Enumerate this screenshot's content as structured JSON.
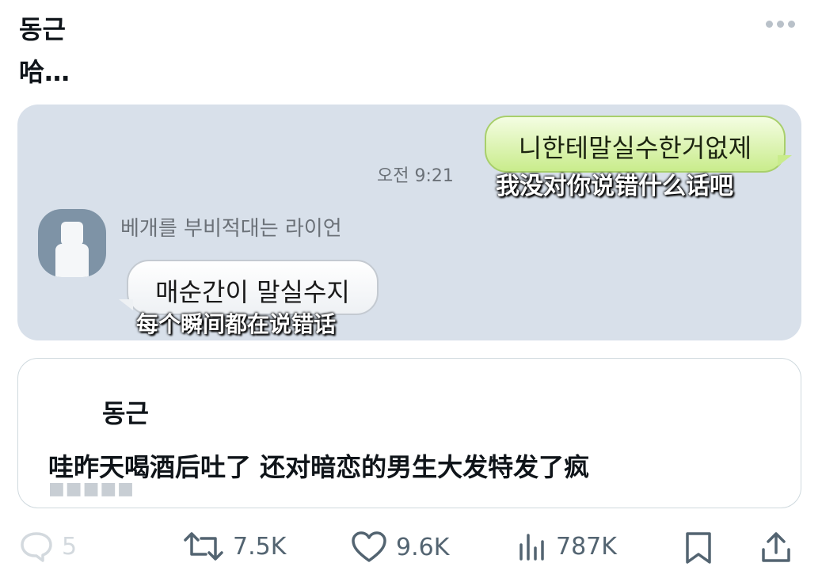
{
  "post": {
    "author": "동근",
    "text": "哈…"
  },
  "media": {
    "outgoing": {
      "korean": "니한테말실수한거없제",
      "subtitle": "我没对你说错什么话吧",
      "time": "오전 9:21"
    },
    "incoming": {
      "sender": "베개를 부비적대는 라이언",
      "korean": "매순간이 말실수지",
      "subtitle": "每个瞬间都在说错话"
    }
  },
  "quoted": {
    "author": "동근",
    "text": "哇昨天喝酒后吐了 还对暗恋的男生大发特发了疯",
    "watermark": "■■■■■"
  },
  "actions": {
    "reply_count": "5",
    "retweet_count": "7.5K",
    "like_count": "9.6K",
    "view_count": "787K"
  },
  "icons": [
    "more-icon",
    "reply-icon",
    "retweet-icon",
    "like-icon",
    "views-icon",
    "bookmark-icon",
    "share-icon"
  ],
  "colors": {
    "bubble_green": "#c9ec8c",
    "media_bg": "#d8e0ea",
    "icon_gray": "#536471"
  }
}
